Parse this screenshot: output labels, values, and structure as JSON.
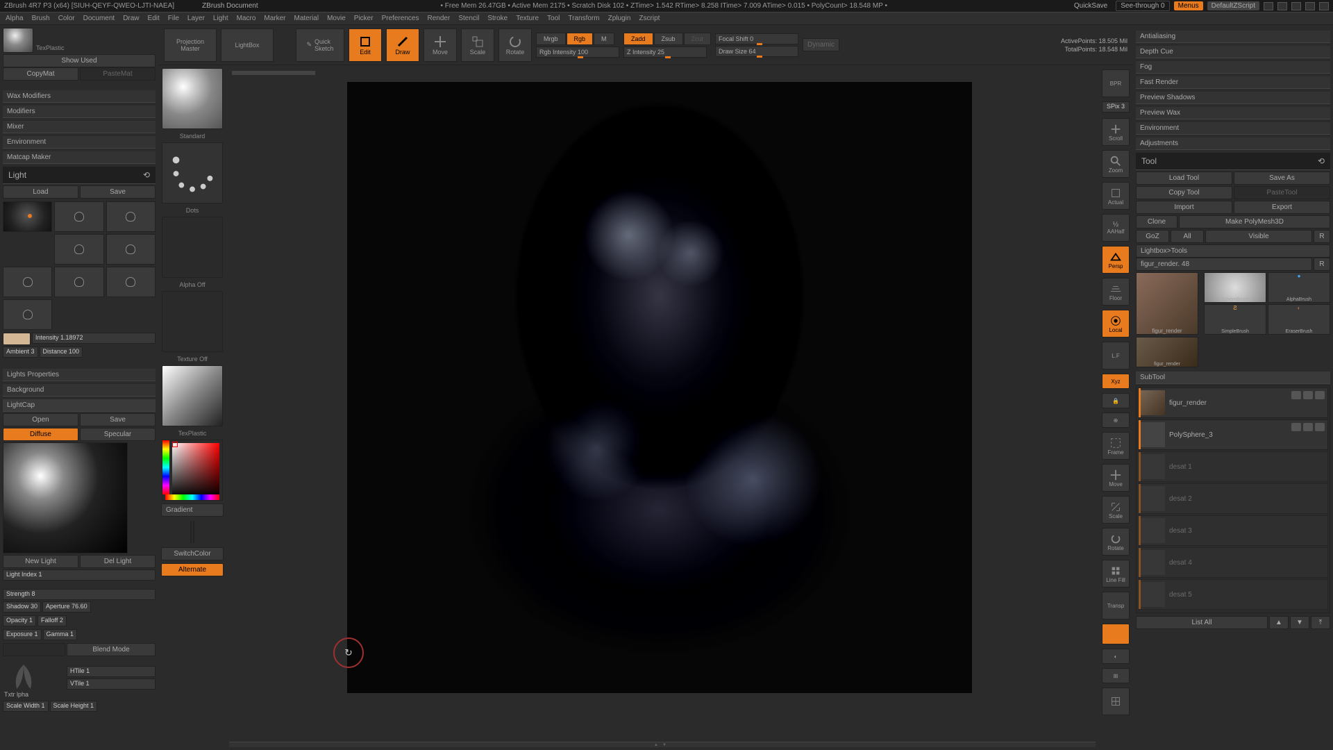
{
  "titlebar": {
    "app": "ZBrush 4R7 P3 (x64) [SIUH-QEYF-QWEO-LJTI-NAEA]",
    "doc": "ZBrush Document",
    "stats": "• Free Mem 26.47GB • Active Mem 2175 • Scratch Disk 102 • ZTime> 1.542  RTime> 8.258  ITime> 7.009  ATime> 0.015 • PolyCount> 18.548 MP •",
    "quicksave": "QuickSave",
    "seethrough": "See-through 0",
    "menus": "Menus",
    "defaultscript": "DefaultZScript"
  },
  "menubar": [
    "Alpha",
    "Brush",
    "Color",
    "Document",
    "Draw",
    "Edit",
    "File",
    "Layer",
    "Light",
    "Macro",
    "Marker",
    "Material",
    "Movie",
    "Picker",
    "Preferences",
    "Render",
    "Stencil",
    "Stroke",
    "Texture",
    "Tool",
    "Transform",
    "Zplugin",
    "Zscript"
  ],
  "left": {
    "texplastic": "TexPlastic",
    "showused": "Show Used",
    "copymat": "CopyMat",
    "pastemat": "PasteMat",
    "sections": [
      "Wax Modifiers",
      "Modifiers",
      "Mixer",
      "Environment",
      "Matcap Maker"
    ],
    "light_title": "Light",
    "load": "Load",
    "save": "Save",
    "intensity": "Intensity 1.18972",
    "ambient": "Ambient 3",
    "distance": "Distance 100",
    "lights_props": "Lights Properties",
    "background": "Background",
    "lightcap": "LightCap",
    "open": "Open",
    "save2": "Save",
    "diffuse": "Diffuse",
    "specular": "Specular",
    "newlight": "New Light",
    "dellight": "Del Light",
    "lightindex": "Light Index 1",
    "strength": "Strength 8",
    "shadow": "Shadow 30",
    "aperture": "Aperture 76.60",
    "opacity": "Opacity 1",
    "falloff": "Falloff 2",
    "exposure": "Exposure 1",
    "gamma": "Gamma 1",
    "blendmode": "Blend Mode",
    "txtr": "Txtr   lpha",
    "htile": "HTile 1",
    "vtile": "VTile 1",
    "scalew": "Scale Width 1",
    "scaleh": "Scale Height 1"
  },
  "tray": {
    "standard": "Standard",
    "dots": "Dots",
    "alphaoff": "Alpha Off",
    "textureoff": "Texture Off",
    "texplastic": "TexPlastic",
    "gradient": "Gradient",
    "switchcolor": "SwitchColor",
    "alternate": "Alternate"
  },
  "toolbar": {
    "projection": "Projection\nMaster",
    "lightbox": "LightBox",
    "quicksketch": "Quick\nSketch",
    "edit": "Edit",
    "draw": "Draw",
    "move": "Move",
    "scale": "Scale",
    "rotate": "Rotate",
    "mrgb": "Mrgb",
    "rgb": "Rgb",
    "m": "M",
    "rgbint": "Rgb Intensity 100",
    "zadd": "Zadd",
    "zsub": "Zsub",
    "zcut": "Zcut",
    "zint": "Z Intensity 25",
    "focal": "Focal Shift 0",
    "drawsize": "Draw Size 64",
    "dynamic": "Dynamic",
    "active": "ActivePoints: 18.505 Mil",
    "total": "TotalPoints: 18.548 Mil"
  },
  "righttray": {
    "bpr": "BPR",
    "spix": "SPix 3",
    "scroll": "Scroll",
    "zoom": "Zoom",
    "actual": "Actual",
    "aahalf": "AAHalf",
    "persp": "Persp",
    "floor": "Floor",
    "local": "Local",
    "lf": "L.F",
    "xyz": "Xyz",
    "frame": "Frame",
    "move": "Move",
    "scale": "Scale",
    "rotate": "Rotate",
    "linefill": "Line Fill",
    "transp": "Transp"
  },
  "right": {
    "render_items": [
      "Antialiasing",
      "Depth Cue",
      "Fog",
      "Fast Render",
      "Preview Shadows",
      "Preview Wax",
      "Environment",
      "Adjustments"
    ],
    "tool_title": "Tool",
    "loadtool": "Load Tool",
    "saveas": "Save As",
    "copytool": "Copy Tool",
    "pastetool": "PasteTool",
    "import": "Import",
    "export": "Export",
    "clone": "Clone",
    "makepoly": "Make PolyMesh3D",
    "goz": "GoZ",
    "all": "All",
    "visible": "Visible",
    "r": "R",
    "lightboxtools": "Lightbox>Tools",
    "toolname": "figur_render. 48",
    "tools": [
      "figur_render",
      "SphereBrush",
      "SimpleBrush",
      "AlphaBrush",
      "EraserBrush",
      "figur_render"
    ],
    "subtool": "SubTool",
    "st1": "figur_render",
    "st2": "PolySphere_3",
    "st3": "desat 1",
    "st4": "desat 2",
    "st5": "desat 3",
    "st6": "desat 4",
    "st7": "desat 5",
    "listall": "List All"
  }
}
